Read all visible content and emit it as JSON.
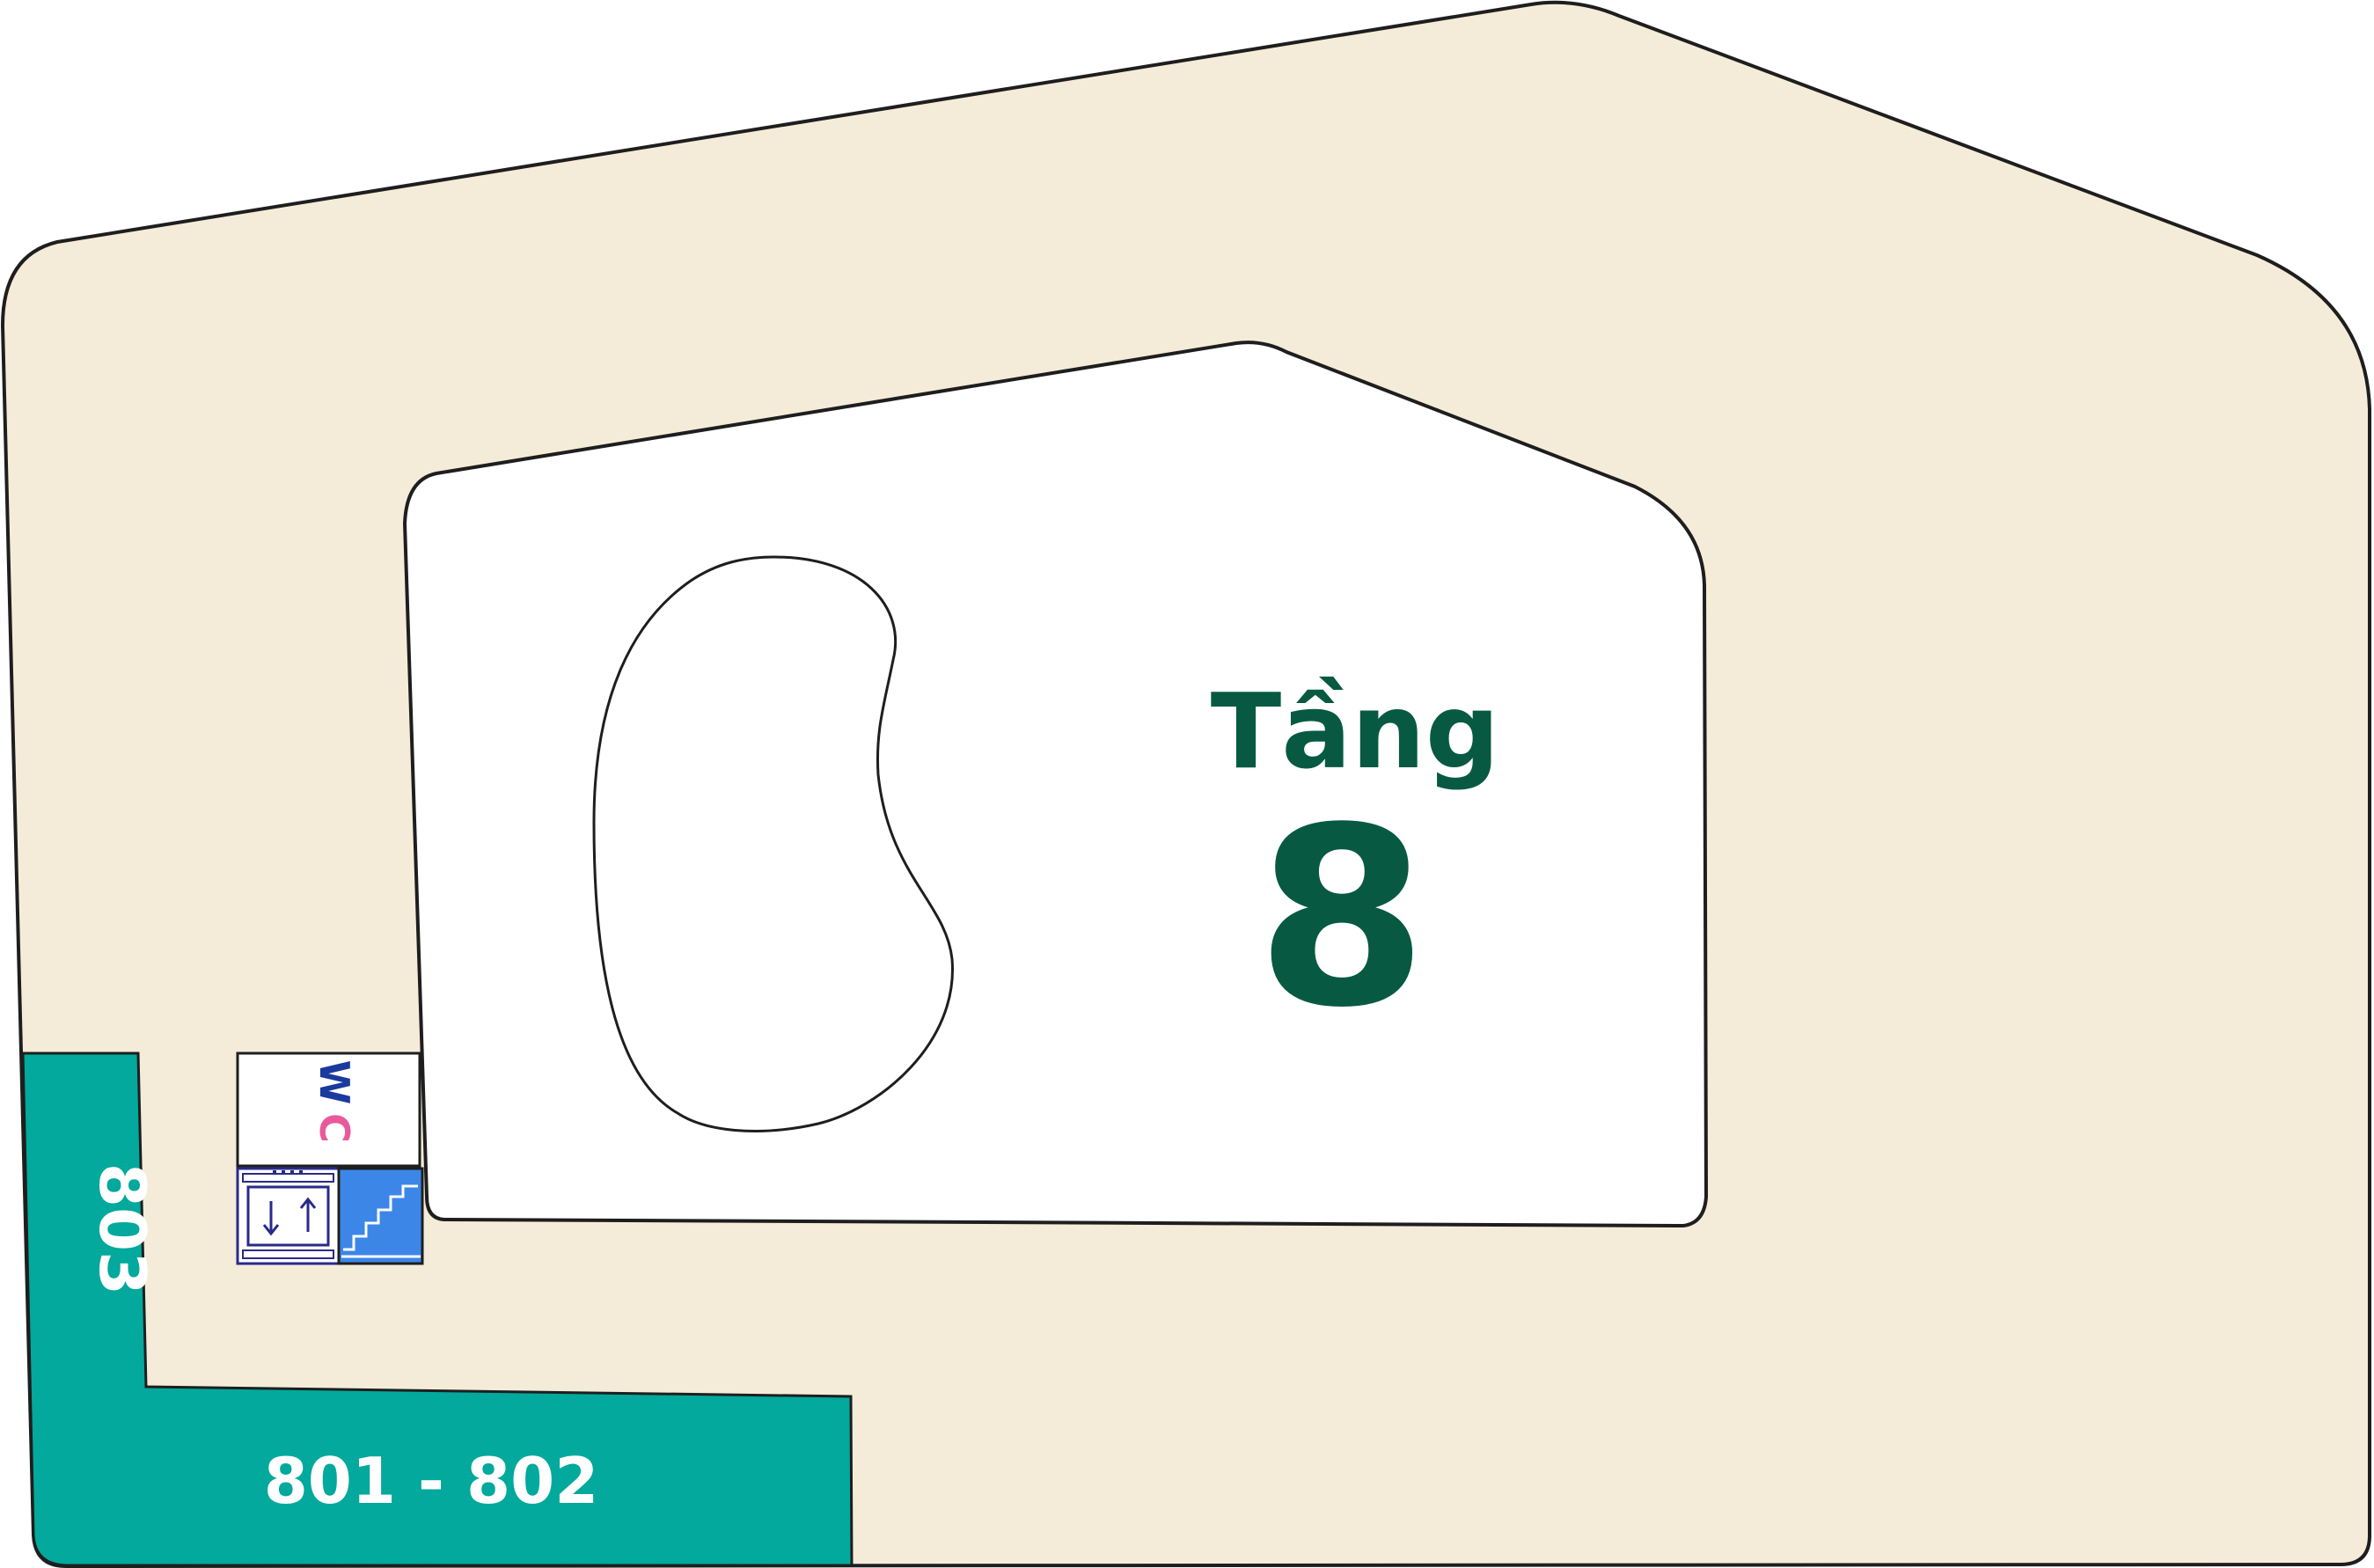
{
  "floor": {
    "label": "Tầng",
    "number": "8"
  },
  "rooms": [
    {
      "id": "801-802",
      "label": "801 - 802"
    },
    {
      "id": "803",
      "label": "803"
    }
  ],
  "facilities": {
    "restroom": {
      "label": "WC",
      "icon": "restroom-icon"
    },
    "elevator": {
      "icon": "elevator-icon"
    },
    "stairs": {
      "icon": "stairs-icon"
    }
  },
  "colors": {
    "floor_fill": "#f4ecd9",
    "courtyard_fill": "#ffffff",
    "room_fill": "#02a99c",
    "floor_title": "#075a41",
    "room_label": "#ffffff",
    "outline": "#1e1e1e",
    "stairs_fill": "#3c86e8",
    "elevator_stroke": "#2a2a8a",
    "wc_blue": "#1a3a9e",
    "wc_pink": "#e85a9b"
  }
}
